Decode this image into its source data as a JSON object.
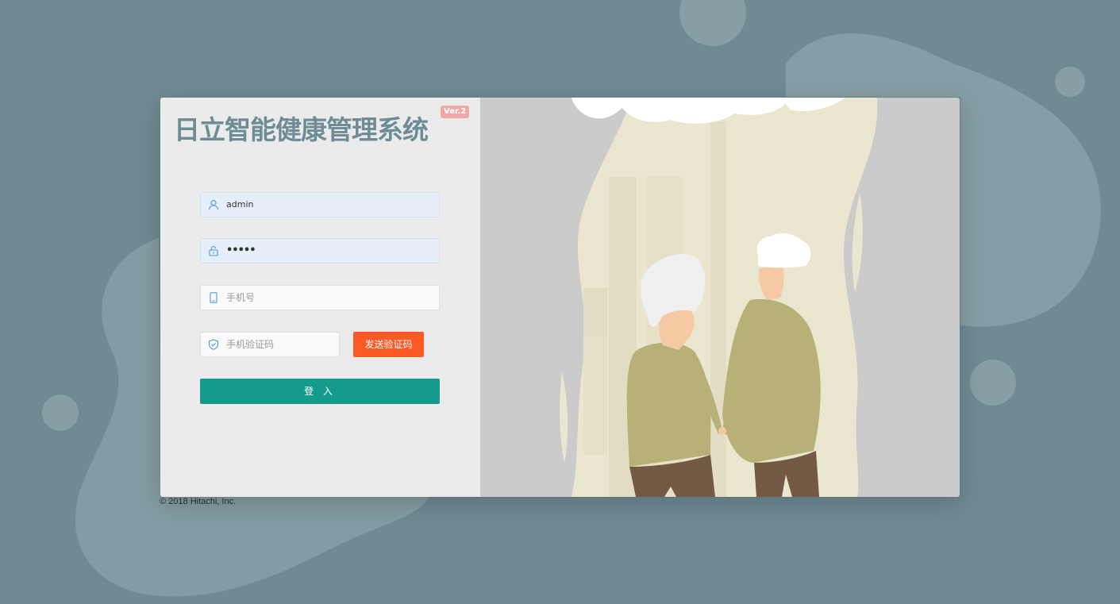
{
  "app": {
    "title": "日立智能健康管理系统",
    "version_badge": "Ver.2"
  },
  "login_form": {
    "username": {
      "value": "admin",
      "icon": "user-icon"
    },
    "password": {
      "value": "•••••",
      "icon": "lock-icon"
    },
    "phone": {
      "placeholder": "手机号",
      "value": "",
      "icon": "mobile-phone-icon"
    },
    "sms_code": {
      "placeholder": "手机验证码",
      "value": "",
      "icon": "shield-check-icon"
    },
    "send_code_label": "发送验证码",
    "login_label": "登 入"
  },
  "footer": {
    "copyright": "© 2018 Hitachi, Inc."
  },
  "colors": {
    "background": "#6f8a93",
    "title": "#6d8c95",
    "send_button": "#fd5a26",
    "login_button": "#159b8b",
    "version_badge": "#f2a7a7",
    "icon_accent": "#4a9ad8"
  }
}
